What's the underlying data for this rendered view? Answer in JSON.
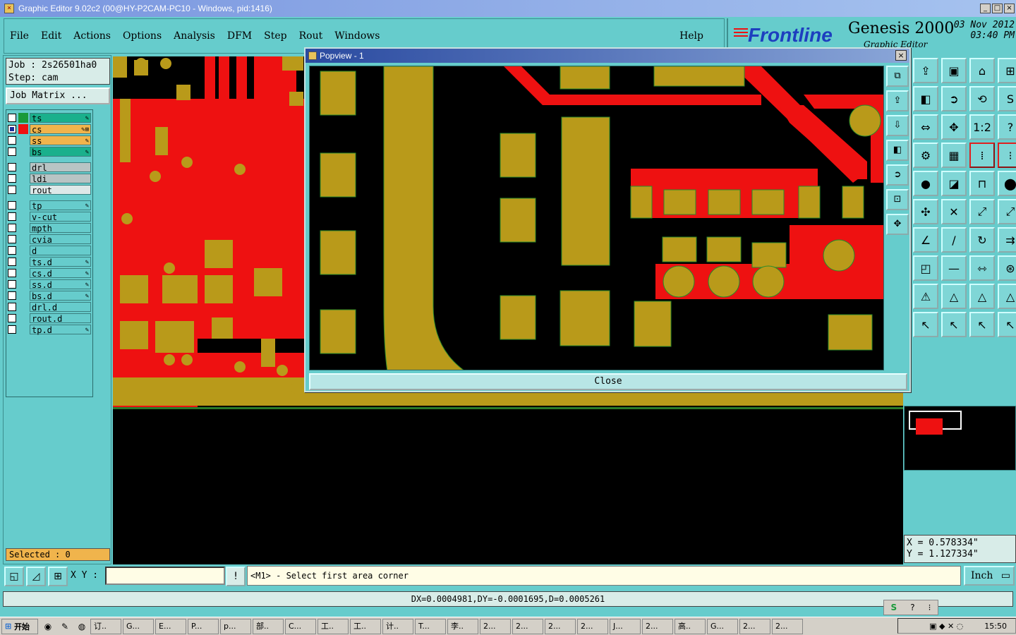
{
  "window": {
    "title": "Graphic Editor 9.02c2 (00@HY-P2CAM-PC10 - Windows, pid:1416)",
    "minimize": "_",
    "maximize": "□",
    "close": "×"
  },
  "menubar": {
    "items": [
      "File",
      "Edit",
      "Actions",
      "Options",
      "Analysis",
      "DFM",
      "Step",
      "Rout",
      "Windows"
    ],
    "help": "Help"
  },
  "brand": {
    "logo": "Frontline",
    "product": "Genesis 2000",
    "subtitle": "Graphic Editor",
    "date": "03 Nov 2012",
    "time": "03:40 PM"
  },
  "job": {
    "job_line": "Job : 2s26501ha0",
    "step_line": "Step: cam",
    "matrix_button": "Job Matrix ..."
  },
  "layers": {
    "groups": [
      [
        {
          "name": "ts",
          "color": "#1a9a3a",
          "bg": "#1ab08c",
          "checked": false,
          "mark": "✎"
        },
        {
          "name": "cs",
          "color": "#ee1111",
          "bg": "#f0b44c",
          "checked": true,
          "mark": "✎⊞"
        },
        {
          "name": "ss",
          "color": "#66cccc",
          "bg": "#f0b44c",
          "checked": false,
          "mark": "✎"
        },
        {
          "name": "bs",
          "color": "#66cccc",
          "bg": "#1ab08c",
          "checked": false,
          "mark": "✎"
        }
      ],
      [
        {
          "name": "drl",
          "color": "#66cccc",
          "bg": "#b8c4c4",
          "checked": false,
          "mark": ""
        },
        {
          "name": "ldi",
          "color": "#66cccc",
          "bg": "#b8c4c4",
          "checked": false,
          "mark": ""
        },
        {
          "name": "rout",
          "color": "#66cccc",
          "bg": "#dde8e8",
          "checked": false,
          "mark": ""
        }
      ],
      [
        {
          "name": "tp",
          "color": "#66cccc",
          "bg": "#66cccc",
          "checked": false,
          "mark": "✎"
        },
        {
          "name": "v-cut",
          "color": "#66cccc",
          "bg": "#66cccc",
          "checked": false,
          "mark": ""
        },
        {
          "name": "mpth",
          "color": "#66cccc",
          "bg": "#66cccc",
          "checked": false,
          "mark": ""
        },
        {
          "name": "cvia",
          "color": "#66cccc",
          "bg": "#66cccc",
          "checked": false,
          "mark": ""
        },
        {
          "name": "d",
          "color": "#66cccc",
          "bg": "#66cccc",
          "checked": false,
          "mark": ""
        },
        {
          "name": "ts.d",
          "color": "#66cccc",
          "bg": "#66cccc",
          "checked": false,
          "mark": "✎"
        },
        {
          "name": "cs.d",
          "color": "#66cccc",
          "bg": "#66cccc",
          "checked": false,
          "mark": "✎"
        },
        {
          "name": "ss.d",
          "color": "#66cccc",
          "bg": "#66cccc",
          "checked": false,
          "mark": "✎"
        },
        {
          "name": "bs.d",
          "color": "#66cccc",
          "bg": "#66cccc",
          "checked": false,
          "mark": "✎"
        },
        {
          "name": "drl.d",
          "color": "#66cccc",
          "bg": "#66cccc",
          "checked": false,
          "mark": ""
        },
        {
          "name": "rout.d",
          "color": "#66cccc",
          "bg": "#66cccc",
          "checked": false,
          "mark": ""
        },
        {
          "name": "tp.d",
          "color": "#66cccc",
          "bg": "#66cccc",
          "checked": false,
          "mark": "✎"
        }
      ]
    ]
  },
  "selected": "Selected : 0",
  "canvas_colors": {
    "copper": "#b99a1a",
    "trace": "#ee1111",
    "background": "#000000"
  },
  "tools": [
    {
      "icon": "⇪",
      "name": "tool-open-icon"
    },
    {
      "icon": "▣",
      "name": "tool-save-icon"
    },
    {
      "icon": "⌂",
      "name": "tool-home-icon"
    },
    {
      "icon": "⊞",
      "name": "tool-frame-icon"
    },
    {
      "icon": "◧",
      "name": "tool-left-icon"
    },
    {
      "icon": "➲",
      "name": "tool-forward-icon"
    },
    {
      "icon": "⟲",
      "name": "tool-undo-icon"
    },
    {
      "icon": "S",
      "name": "tool-snap-icon"
    },
    {
      "icon": "⇔",
      "name": "tool-pan-icon"
    },
    {
      "icon": "✥",
      "name": "tool-move-icon"
    },
    {
      "icon": "1:2",
      "name": "tool-scale-icon"
    },
    {
      "icon": "?",
      "name": "tool-help-icon"
    },
    {
      "icon": "⚙",
      "name": "tool-settings-icon"
    },
    {
      "icon": "▦",
      "name": "tool-grid-icon"
    },
    {
      "icon": "⁞",
      "name": "tool-net-icon",
      "sel": true
    },
    {
      "icon": "⁝",
      "name": "tool-net2-icon",
      "sel": true
    },
    {
      "icon": "●",
      "name": "tool-pad-icon"
    },
    {
      "icon": "◪",
      "name": "tool-fill-icon"
    },
    {
      "icon": "⊓",
      "name": "tool-ruler-icon"
    },
    {
      "icon": "⬤",
      "name": "tool-circle-icon"
    },
    {
      "icon": "✣",
      "name": "tool-connect-icon"
    },
    {
      "icon": "✕",
      "name": "tool-cross-icon"
    },
    {
      "icon": "⤢",
      "name": "tool-line-icon"
    },
    {
      "icon": "⤢",
      "name": "tool-line2-icon"
    },
    {
      "icon": "∠",
      "name": "tool-angle-icon"
    },
    {
      "icon": "/",
      "name": "tool-slash-icon"
    },
    {
      "icon": "↻",
      "name": "tool-arc-icon"
    },
    {
      "icon": "⇉",
      "name": "tool-route-icon"
    },
    {
      "icon": "◰",
      "name": "tool-select-icon"
    },
    {
      "icon": "—",
      "name": "tool-segment-icon"
    },
    {
      "icon": "⇿",
      "name": "tool-measure-icon"
    },
    {
      "icon": "⊛",
      "name": "tool-pattern-icon"
    },
    {
      "icon": "⚠",
      "name": "tool-warn-icon"
    },
    {
      "icon": "△",
      "name": "tool-tri-icon"
    },
    {
      "icon": "△",
      "name": "tool-tri2-icon"
    },
    {
      "icon": "△",
      "name": "tool-tri3-icon"
    },
    {
      "icon": "↖",
      "name": "tool-pointer-icon"
    },
    {
      "icon": "↖",
      "name": "tool-pointer2-icon"
    },
    {
      "icon": "↖",
      "name": "tool-pointer3-icon"
    },
    {
      "icon": "↖",
      "name": "tool-pointer4-icon"
    }
  ],
  "coords": {
    "x": "X = 0.578334\"",
    "y": "Y = 1.127334\""
  },
  "command": {
    "xy_label": "X Y :",
    "xy_value": "",
    "prompt": "<M1> - Select first area corner",
    "units": "Inch"
  },
  "status": "DX=0.0004981,DY=-0.0001695,D=0.0005261",
  "popview": {
    "title": "Popview - 1",
    "close_button": "Close",
    "close_x": "×"
  },
  "taskbar": {
    "start": "开始",
    "buttons": [
      "订..",
      "G...",
      "E...",
      "P...",
      "p...",
      "部..",
      "C...",
      "工..",
      "工..",
      "计..",
      "T...",
      "李..",
      "2...",
      "2...",
      "2...",
      "2...",
      "J...",
      "2...",
      "高..",
      "G...",
      "2...",
      "2..."
    ],
    "clock": "15:50"
  }
}
